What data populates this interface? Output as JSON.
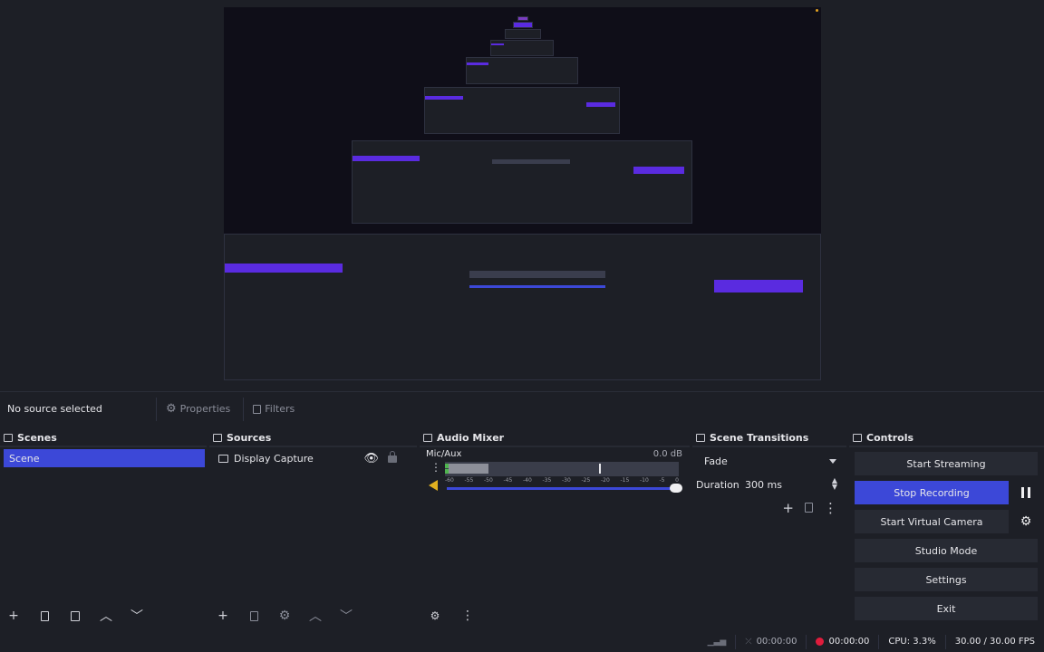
{
  "context_bar": {
    "no_source_label": "No source selected",
    "properties_label": "Properties",
    "filters_label": "Filters"
  },
  "docks": {
    "scenes": {
      "title": "Scenes",
      "items": [
        "Scene"
      ]
    },
    "sources": {
      "title": "Sources",
      "items": [
        "Display Capture"
      ]
    },
    "mixer": {
      "title": "Audio Mixer",
      "track_name": "Mic/Aux",
      "track_db": "0.0 dB",
      "ticks": [
        "-60",
        "-55",
        "-50",
        "-45",
        "-40",
        "-35",
        "-30",
        "-25",
        "-20",
        "-15",
        "-10",
        "-5",
        "0"
      ],
      "volume_level": 1.0
    },
    "transitions": {
      "title": "Scene Transitions",
      "selected": "Fade",
      "duration_label": "Duration",
      "duration_value": "300 ms"
    },
    "controls": {
      "title": "Controls",
      "start_streaming": "Start Streaming",
      "stop_recording": "Stop Recording",
      "start_virtual_camera": "Start Virtual Camera",
      "studio_mode": "Studio Mode",
      "settings": "Settings",
      "exit": "Exit"
    }
  },
  "status_bar": {
    "stream_time": "00:00:00",
    "rec_time": "00:00:00",
    "cpu": "CPU: 3.3%",
    "fps": "30.00 / 30.00 FPS"
  },
  "colors": {
    "accent": "#3c48d8",
    "preview_accent": "#5a2be0",
    "record_red": "#e01c3c",
    "meter_green": "#4fb54f",
    "volume_yellow": "#e0b020",
    "background": "#1d1f26",
    "panel": "#272a33"
  },
  "icons": {
    "properties": "gear-icon",
    "filters": "filter-icon",
    "dock": "window-icon",
    "source_type": "monitor-icon",
    "visibility": "eye-icon",
    "lock": "lock-icon",
    "pause": "pause-icon",
    "virtual_camera_settings": "gear-icon"
  }
}
